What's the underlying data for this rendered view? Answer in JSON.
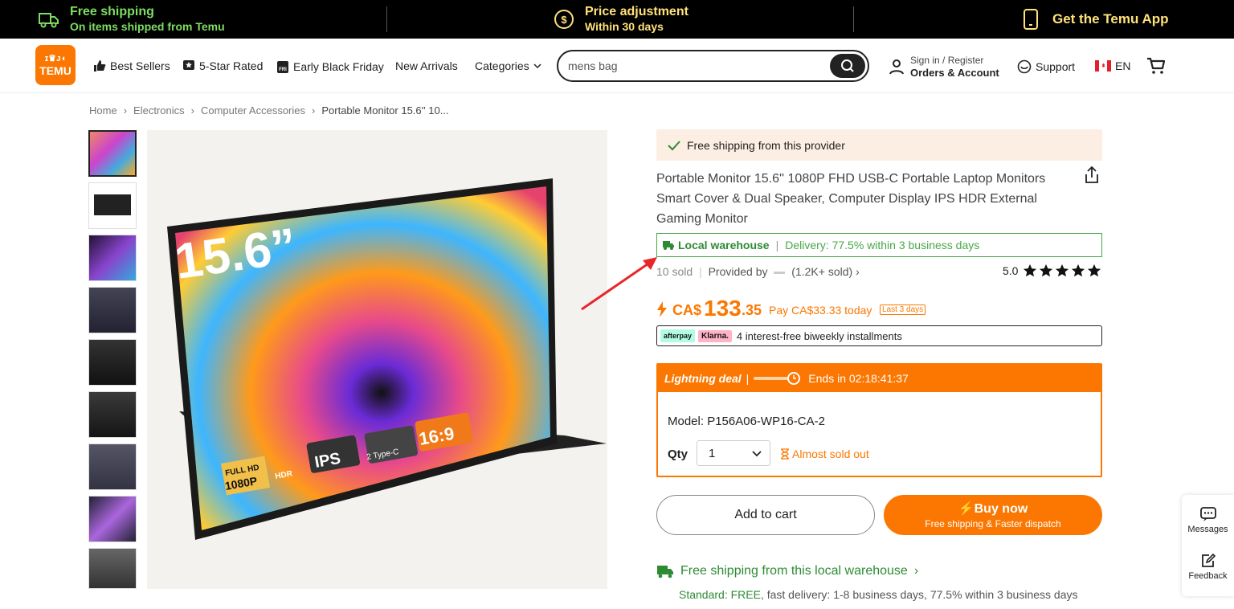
{
  "topbar": {
    "shipping_title": "Free shipping",
    "shipping_sub": "On items shipped from Temu",
    "price_title": "Price adjustment",
    "price_sub": "Within 30 days",
    "app": "Get the Temu App"
  },
  "header": {
    "logo_top": "ɪ♛ᴊ◖",
    "logo_text": "TEMU",
    "nav": [
      "Best Sellers",
      "5-Star Rated",
      "Early Black Friday",
      "New Arrivals",
      "Categories"
    ],
    "search_value": "mens bag",
    "sign_in": "Sign in / Register",
    "orders": "Orders & Account",
    "support": "Support",
    "lang": "EN"
  },
  "breadcrumb": [
    "Home",
    "Electronics",
    "Computer Accessories",
    "Portable Monitor 15.6'' 10..."
  ],
  "product": {
    "free_shipping": "Free shipping from this provider",
    "title": "Portable Monitor 15.6'' 1080P FHD USB-C Portable Laptop Monitors Smart Cover & Dual Speaker, Computer Display IPS HDR External Gaming Monitor",
    "warehouse": "Local warehouse",
    "delivery": "Delivery: 77.5% within 3 business days",
    "sold": "10 sold",
    "provided_by": "Provided by",
    "provider_sold": "(1.2K+ sold)",
    "rating": "5.0",
    "currency": "CA$",
    "price_main": "133",
    "price_cents": ".35",
    "pay_today": "Pay CA$33.33 today",
    "last_days": "Last 3 days",
    "afterpay": "afterpay",
    "klarna": "Klarna.",
    "installments": "4 interest-free biweekly installments",
    "deal_label": "Lightning deal",
    "deal_ends": "Ends in 02:18:41:37",
    "model": "Model: P156A06-WP16-CA-2",
    "qty_label": "Qty",
    "qty_value": "1",
    "almost": "Almost sold out",
    "add_to_cart": "Add to cart",
    "buy_now": "Buy now",
    "buy_sub": "Free shipping & Faster dispatch",
    "local_ship": "Free shipping from this local warehouse",
    "standard": "Standard: FREE,",
    "standard_rest": "fast delivery: 1-8 business days, 77.5% within 3 business days"
  },
  "image_text": {
    "size": "15.6”",
    "ips": "IPS",
    "typec": "2 Type-C",
    "ratio": "16:9",
    "fullhd": "FULL HD",
    "res": "1080P",
    "hdr": "HDR"
  },
  "sidebar": {
    "messages": "Messages",
    "feedback": "Feedback"
  },
  "colors": {
    "brand": "#fb7701",
    "green": "#49a74b",
    "topbar_green": "#7dde63",
    "topbar_yellow": "#ffe27a"
  }
}
